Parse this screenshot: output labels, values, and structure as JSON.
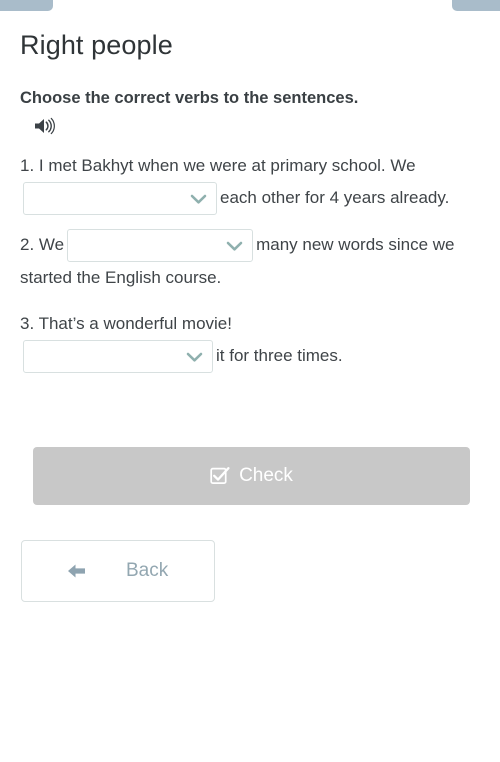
{
  "page": {
    "title": "Right people",
    "background_color": "#ffffff",
    "text_color": "#3f4448"
  },
  "progress": {
    "left_segment_color": "#a9bcca",
    "right_segment_color": "#a9bcca"
  },
  "task": {
    "prompt": "Choose the correct verbs to the sentences.",
    "audio_icon": "speaker-icon"
  },
  "sentences": [
    {
      "number": "1.",
      "part1": "1. I met Bakhyt when we were at primary school. We",
      "dropdown_value": "",
      "part2": "each other for 4 years already."
    },
    {
      "number": "2.",
      "part1": "2. We",
      "dropdown_value": "",
      "part2": "many new words since we started the English course."
    },
    {
      "number": "3.",
      "part1": "3. That’s a wonderful movie!",
      "dropdown_value": "",
      "part2": "it for three times."
    }
  ],
  "dropdown": {
    "chevron_icon": "chevron-down-icon",
    "chevron_color": "#8fb0ae",
    "border_color": "#d8e0e0"
  },
  "buttons": {
    "check": {
      "label": "Check",
      "icon": "checkbox-checked-icon",
      "background_color": "#c8c8c8",
      "text_color": "#ffffff",
      "disabled": true
    },
    "back": {
      "label": "Back",
      "icon": "arrow-left-icon",
      "icon_color": "#8ea3b0",
      "text_color": "#93a7b1",
      "border_color": "#d9e0e0"
    }
  }
}
